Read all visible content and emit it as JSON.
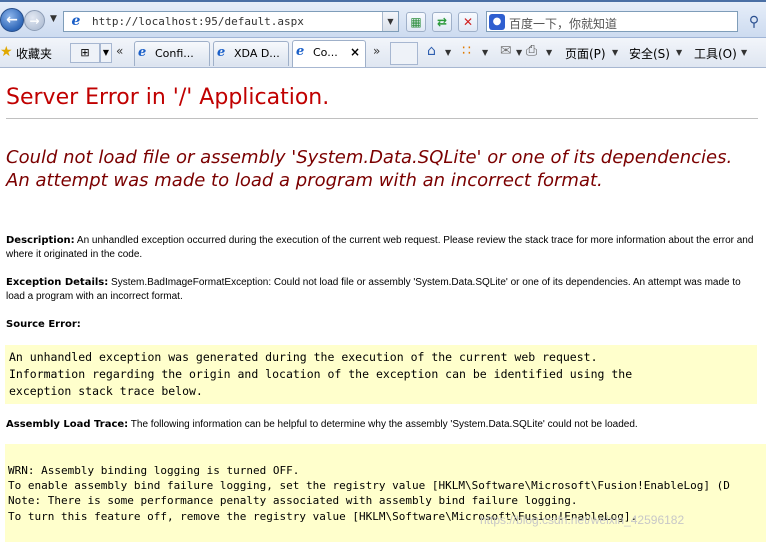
{
  "browser": {
    "address": "http://localhost:95/default.aspx",
    "search_placeholder": "百度一下，你就知道",
    "favorites_label": "收藏夹",
    "tabs": [
      {
        "label": "Confi..."
      },
      {
        "label": "XDA D..."
      },
      {
        "label": "Co...",
        "close": "×"
      }
    ],
    "commands": {
      "page": "页面(P)",
      "safety": "安全(S)",
      "tools": "工具(O)"
    }
  },
  "page": {
    "title": "Server Error in '/' Application.",
    "error_message": "Could not load file or assembly 'System.Data.SQLite' or one of its dependencies. An attempt was made to load a program with an incorrect format.",
    "description_label": "Description:",
    "description_text": "An unhandled exception occurred during the execution of the current web request. Please review the stack trace for more information about the error and where it originated in the code.",
    "exception_label": "Exception Details:",
    "exception_text": "System.BadImageFormatException: Could not load file or assembly 'System.Data.SQLite' or one of its dependencies. An attempt was made to load a program with an incorrect format.",
    "source_error_label": "Source Error:",
    "source_error_lines": [
      "An unhandled exception was generated during the execution of the current web request.",
      "Information regarding the origin and location of the exception can be identified using the",
      "exception stack trace below."
    ],
    "assembly_trace_label": "Assembly Load Trace:",
    "assembly_trace_text": "The following information can be helpful to determine why the assembly 'System.Data.SQLite' could not be loaded.",
    "trace_lines": [
      "WRN: Assembly binding logging is turned OFF.",
      "To enable assembly bind failure logging, set the registry value [HKLM\\Software\\Microsoft\\Fusion!EnableLog] (D",
      "Note: There is some performance penalty associated with assembly bind failure logging.",
      "To turn this feature off, remove the registry value [HKLM\\Software\\Microsoft\\Fusion!EnableLog]."
    ],
    "watermark": "https://blog.csdn.net/weixin_42596182"
  },
  "colors": {
    "title_red": "#c00000",
    "message_red": "#7b0000",
    "code_bg": "#ffffcc"
  }
}
